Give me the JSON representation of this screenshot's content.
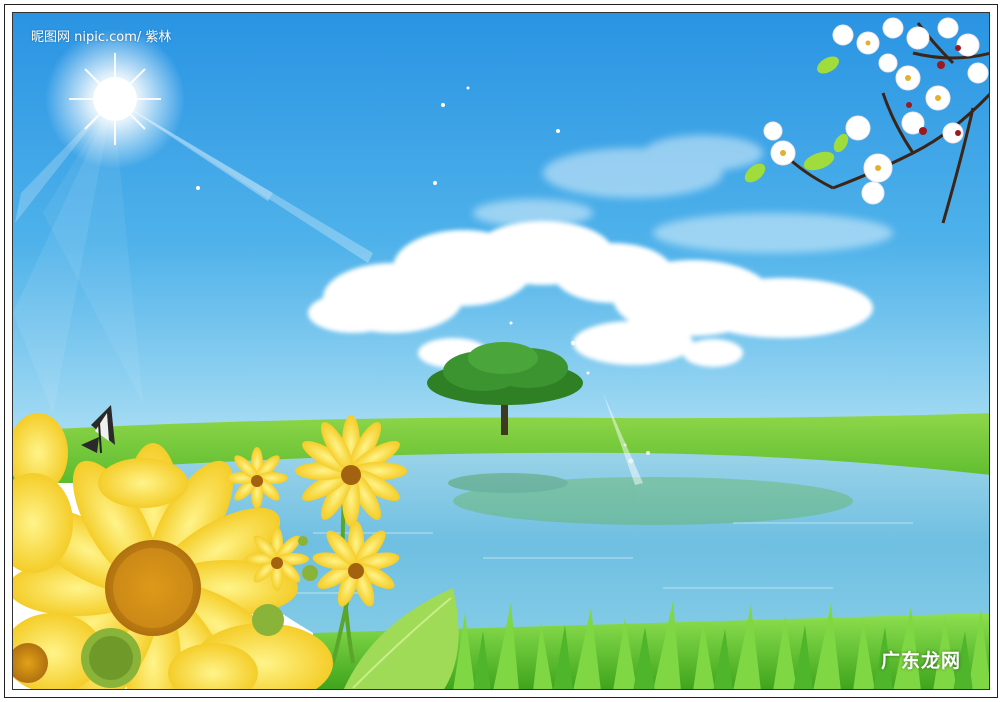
{
  "watermarks": {
    "top_left": "昵图网 nipic.com/ 紫林",
    "bottom_right": "广东龙网"
  },
  "colors": {
    "sky_top": "#1f8fe0",
    "sky_bottom": "#8fd2f0",
    "grass": "#6cc83a",
    "water": "#7cc3e3",
    "sunflower": "#f6d62a",
    "blossom": "#ffffff"
  }
}
